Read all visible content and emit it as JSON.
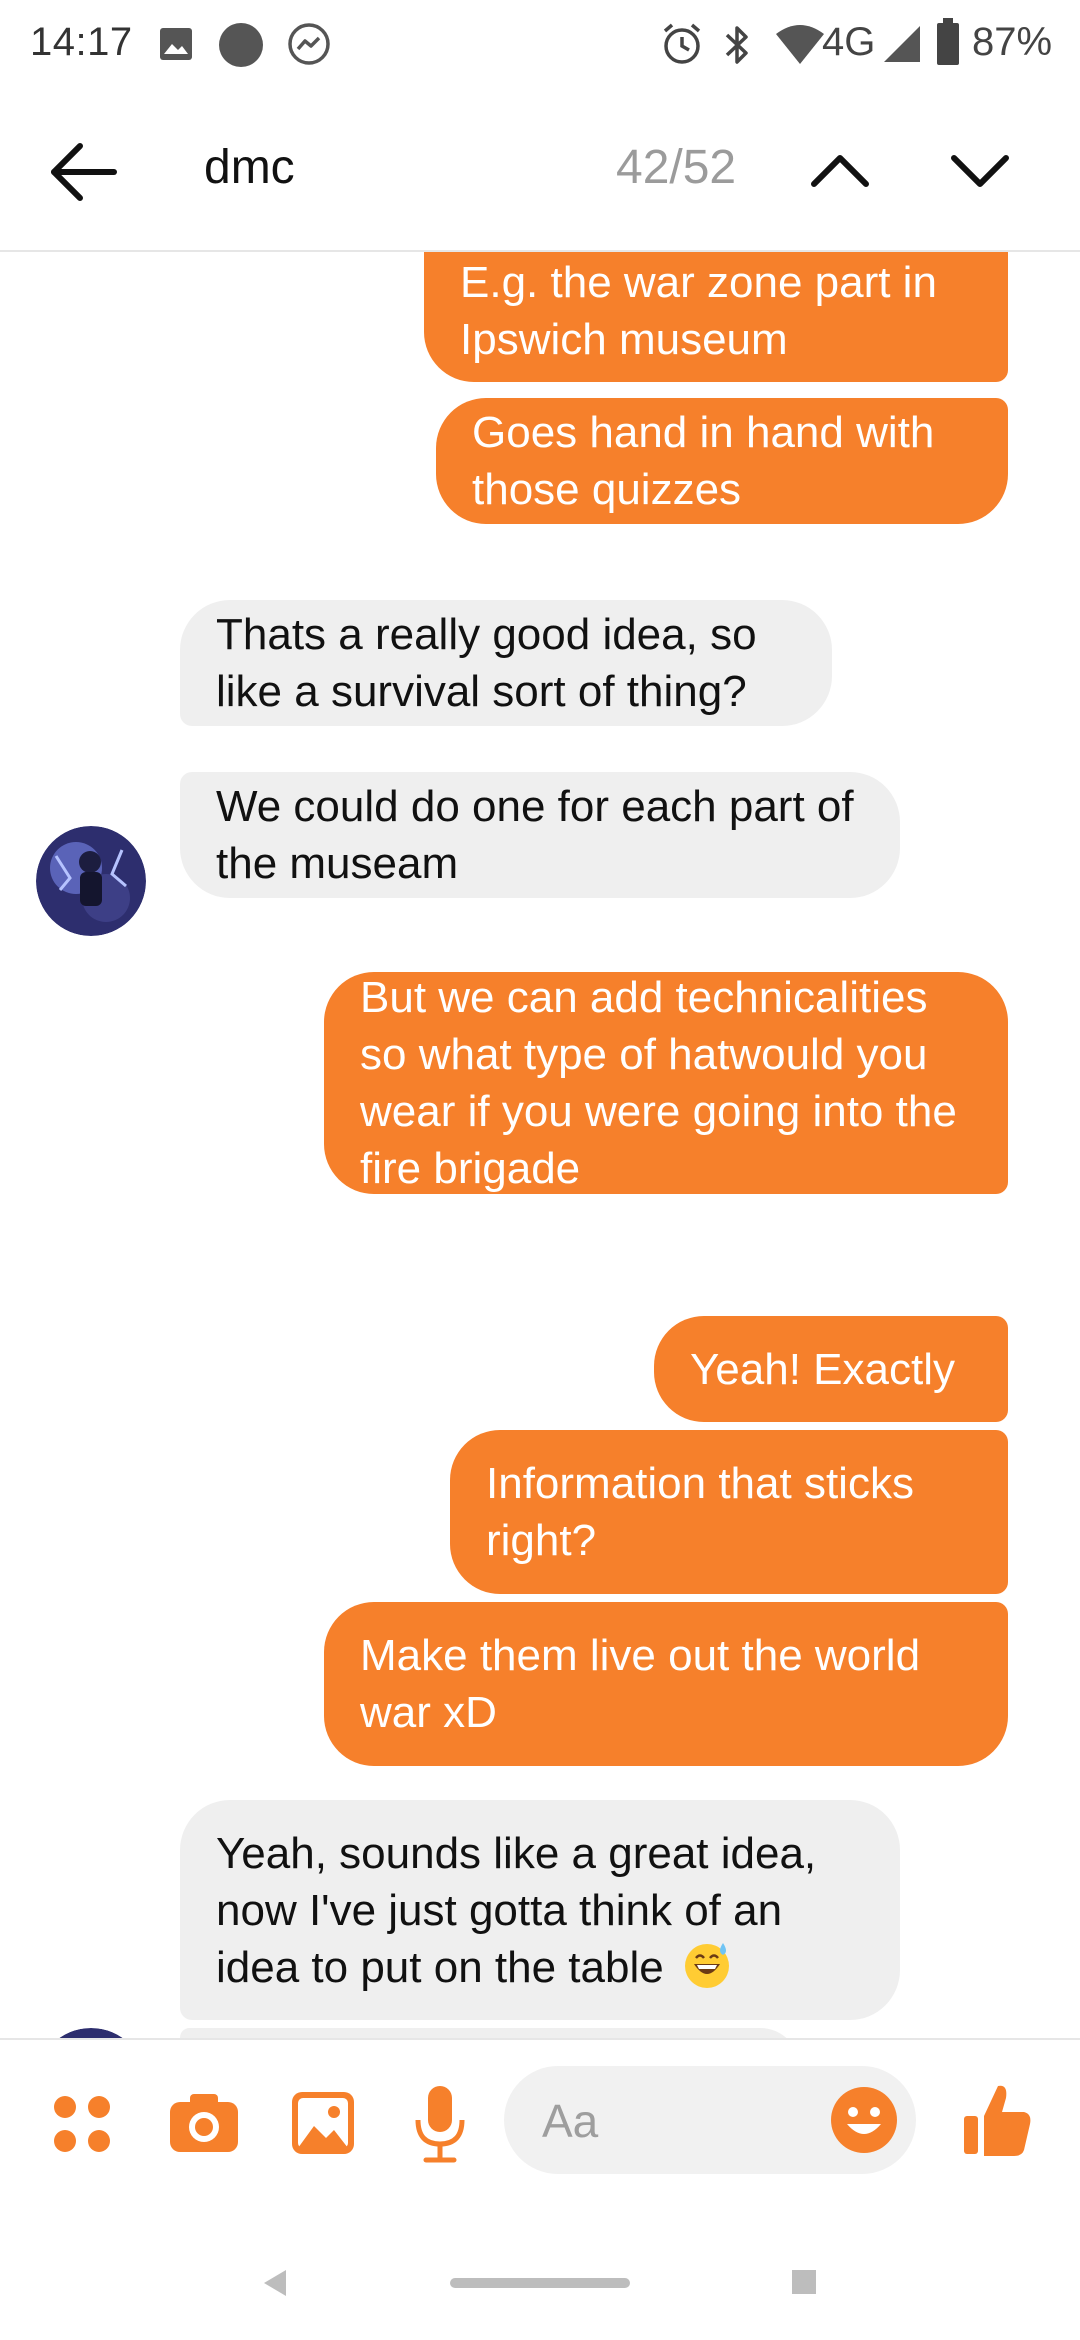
{
  "status_bar": {
    "time": "14:17",
    "network": "4G",
    "battery": "87%",
    "icons": [
      "image-icon",
      "dot-icon",
      "messenger-icon",
      "alarm-icon",
      "bluetooth-icon",
      "wifi-icon",
      "signal-icon",
      "battery-icon"
    ]
  },
  "search": {
    "query": "dmc",
    "counter": "42/52"
  },
  "messages": [
    {
      "side": "out",
      "text": "E.g. the war zone part in Ipswich museum"
    },
    {
      "side": "out",
      "text": "Goes hand in hand with those quizzes"
    },
    {
      "side": "in",
      "text": "Thats a really good idea, so like a survival sort of thing?"
    },
    {
      "side": "in",
      "text": "We could do one for each part of the museam"
    },
    {
      "side": "out",
      "text": "But we can add technicalities so what type of hatwould you wear if you were going into the fire brigade"
    },
    {
      "side": "out",
      "text": "Yeah! Exactly"
    },
    {
      "side": "out",
      "text": "Information that sticks right?"
    },
    {
      "side": "out",
      "text": "Make them live out the world war xD"
    },
    {
      "side": "in",
      "text": "Yeah, sounds like a great idea, now I've just gotta think of an idea to put on the table"
    }
  ],
  "composer": {
    "placeholder": "Aa"
  },
  "colors": {
    "accent": "#f6802b",
    "incoming_bubble": "#efefef"
  }
}
